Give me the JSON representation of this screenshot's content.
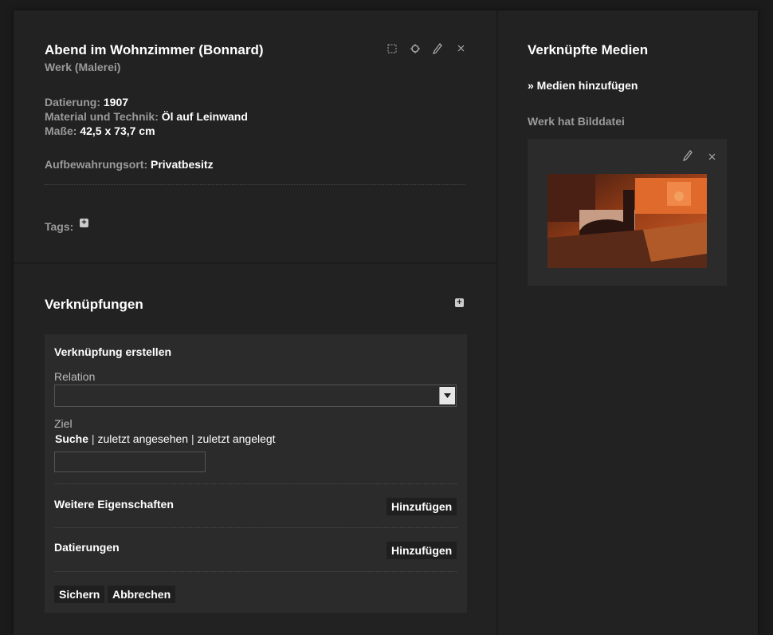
{
  "work": {
    "title": "Abend im Wohnzimmer (Bonnard)",
    "subtitle": "Werk (Malerei)",
    "fields": [
      {
        "label": "Datierung:",
        "value": "1907"
      },
      {
        "label": "Material und Technik:",
        "value": "Öl auf Leinwand"
      },
      {
        "label": "Maße:",
        "value": "42,5 x 73,7 cm"
      }
    ],
    "location_label": "Aufbewahrungsort:",
    "location_value": "Privatbesitz",
    "tags_label": "Tags:"
  },
  "links": {
    "title": "Verknüpfungen",
    "form": {
      "title": "Verknüpfung erstellen",
      "relation_label": "Relation",
      "target_label": "Ziel",
      "search_tabs": [
        "Suche",
        "zuletzt angesehen",
        "zuletzt angelegt"
      ],
      "separator": "|",
      "more_props_label": "Weitere Eigenschaften",
      "more_props_button": "Hinzufügen",
      "dates_label": "Datierungen",
      "dates_button": "Hinzufügen",
      "save_button": "Sichern",
      "cancel_button": "Abbrechen"
    }
  },
  "media": {
    "title": "Verknüpfte Medien",
    "add_link": "» Medien hinzufügen",
    "caption": "Werk hat Bilddatei"
  },
  "colors": {
    "background": "#1b1b1b",
    "panel": "#222222",
    "subpanel": "#2b2b2b",
    "text": "#ffffff",
    "muted": "#9a9a9a"
  }
}
